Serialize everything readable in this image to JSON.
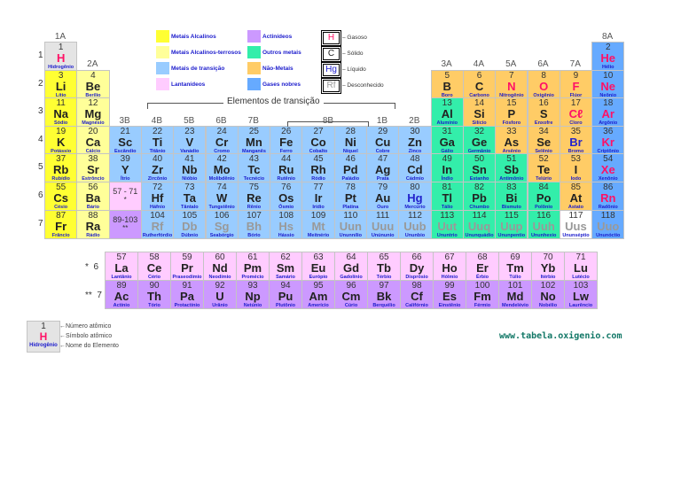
{
  "colors": {
    "alk": "#ffff33",
    "ae": "#ffff99",
    "tr": "#99ccff",
    "lan": "#ffccff",
    "act": "#cc99ff",
    "oth": "#33eeaa",
    "non": "#ffcc66",
    "nob": "#66aaff",
    "none": "#ffffff",
    "h": "#e4e4e4"
  },
  "state_colors": {
    "g": "#ff1166",
    "s": "#222222",
    "l": "#2222cc",
    "u": "#999999"
  },
  "groups": [
    "1A",
    "2A",
    "3B",
    "4B",
    "5B",
    "6B",
    "7B",
    "8B",
    "1B",
    "2B",
    "3A",
    "4A",
    "5A",
    "6A",
    "7A",
    "8A"
  ],
  "periods": [
    "1",
    "2",
    "3",
    "4",
    "5",
    "6",
    "7"
  ],
  "transition_title": "Elementos de transição",
  "legend": {
    "alk": "Metais Alcalinos",
    "ae": "Metais Alcalinos-terrosos",
    "tr": "Metais de transição",
    "lan": "Lantanídeos",
    "act": "Actinídeos",
    "oth": "Outros metais",
    "non": "Não-Metais",
    "nob": "Gases nobres"
  },
  "states": [
    {
      "sym": "H",
      "label": "Gasoso",
      "state": "g"
    },
    {
      "sym": "C",
      "label": "Sólido",
      "state": "s"
    },
    {
      "sym": "Hg",
      "label": "Líquido",
      "state": "l"
    },
    {
      "sym": "Rf",
      "label": "Desconhecido",
      "state": "u"
    }
  ],
  "placeholders": {
    "lan": {
      "range": "57 - 71",
      "mark": "*"
    },
    "act": {
      "range": "89-103",
      "mark": "**"
    }
  },
  "fblock_labels": {
    "lan": "*  6",
    "act": "**  7"
  },
  "key": {
    "num": "1",
    "sym": "H",
    "name": "Hidrogênio",
    "labels": [
      "Número atômico",
      "Símbolo atômico",
      "Nome do Elemento"
    ]
  },
  "website": "www.tabela.oxigenio.com",
  "elements": [
    [
      1,
      "H",
      "Hidrogênio",
      "h",
      "g",
      1,
      1
    ],
    [
      2,
      "He",
      "Hélio",
      "nob",
      "g",
      18,
      1
    ],
    [
      3,
      "Li",
      "Lítio",
      "alk",
      "s",
      1,
      2
    ],
    [
      4,
      "Be",
      "Berílio",
      "ae",
      "s",
      2,
      2
    ],
    [
      5,
      "B",
      "Boro",
      "non",
      "s",
      13,
      2
    ],
    [
      6,
      "C",
      "Carbono",
      "non",
      "s",
      14,
      2
    ],
    [
      7,
      "N",
      "Nitrogênio",
      "non",
      "g",
      15,
      2
    ],
    [
      8,
      "O",
      "Oxigênio",
      "non",
      "g",
      16,
      2
    ],
    [
      9,
      "F",
      "Flúor",
      "non",
      "g",
      17,
      2
    ],
    [
      10,
      "Ne",
      "Neônio",
      "nob",
      "g",
      18,
      2
    ],
    [
      11,
      "Na",
      "Sódio",
      "alk",
      "s",
      1,
      3
    ],
    [
      12,
      "Mg",
      "Magnésio",
      "ae",
      "s",
      2,
      3
    ],
    [
      13,
      "Al",
      "Alumínio",
      "oth",
      "s",
      13,
      3
    ],
    [
      14,
      "Si",
      "Silício",
      "non",
      "s",
      14,
      3
    ],
    [
      15,
      "P",
      "Fósforo",
      "non",
      "s",
      15,
      3
    ],
    [
      16,
      "S",
      "Enxofre",
      "non",
      "s",
      16,
      3
    ],
    [
      17,
      "Cℓ",
      "Cloro",
      "non",
      "g",
      17,
      3
    ],
    [
      18,
      "Ar",
      "Argônio",
      "nob",
      "g",
      18,
      3
    ],
    [
      19,
      "K",
      "Potássio",
      "alk",
      "s",
      1,
      4
    ],
    [
      20,
      "Ca",
      "Cálcio",
      "ae",
      "s",
      2,
      4
    ],
    [
      21,
      "Sc",
      "Escândio",
      "tr",
      "s",
      3,
      4
    ],
    [
      22,
      "Ti",
      "Titânio",
      "tr",
      "s",
      4,
      4
    ],
    [
      23,
      "V",
      "Vanádio",
      "tr",
      "s",
      5,
      4
    ],
    [
      24,
      "Cr",
      "Cromo",
      "tr",
      "s",
      6,
      4
    ],
    [
      25,
      "Mn",
      "Manganês",
      "tr",
      "s",
      7,
      4
    ],
    [
      26,
      "Fe",
      "Ferro",
      "tr",
      "s",
      8,
      4
    ],
    [
      27,
      "Co",
      "Cobalto",
      "tr",
      "s",
      9,
      4
    ],
    [
      28,
      "Ni",
      "Níquel",
      "tr",
      "s",
      10,
      4
    ],
    [
      29,
      "Cu",
      "Cobre",
      "tr",
      "s",
      11,
      4
    ],
    [
      30,
      "Zn",
      "Zinco",
      "tr",
      "s",
      12,
      4
    ],
    [
      31,
      "Ga",
      "Gálio",
      "oth",
      "s",
      13,
      4
    ],
    [
      32,
      "Ge",
      "Germânio",
      "oth",
      "s",
      14,
      4
    ],
    [
      33,
      "As",
      "Arsênio",
      "non",
      "s",
      15,
      4
    ],
    [
      34,
      "Se",
      "Selênio",
      "non",
      "s",
      16,
      4
    ],
    [
      35,
      "Br",
      "Bromo",
      "non",
      "l",
      17,
      4
    ],
    [
      36,
      "Kr",
      "Criptônio",
      "nob",
      "g",
      18,
      4
    ],
    [
      37,
      "Rb",
      "Rubídio",
      "alk",
      "s",
      1,
      5
    ],
    [
      38,
      "Sr",
      "Estrôncio",
      "ae",
      "s",
      2,
      5
    ],
    [
      39,
      "Y",
      "Ítrio",
      "tr",
      "s",
      3,
      5
    ],
    [
      40,
      "Zr",
      "Zircônio",
      "tr",
      "s",
      4,
      5
    ],
    [
      41,
      "Nb",
      "Nióbio",
      "tr",
      "s",
      5,
      5
    ],
    [
      42,
      "Mo",
      "Molibdênio",
      "tr",
      "s",
      6,
      5
    ],
    [
      43,
      "Tc",
      "Tecnécio",
      "tr",
      "s",
      7,
      5
    ],
    [
      44,
      "Ru",
      "Rutênio",
      "tr",
      "s",
      8,
      5
    ],
    [
      45,
      "Rh",
      "Ródio",
      "tr",
      "s",
      9,
      5
    ],
    [
      46,
      "Pd",
      "Paládio",
      "tr",
      "s",
      10,
      5
    ],
    [
      47,
      "Ag",
      "Prata",
      "tr",
      "s",
      11,
      5
    ],
    [
      48,
      "Cd",
      "Cádmio",
      "tr",
      "s",
      12,
      5
    ],
    [
      49,
      "In",
      "Índio",
      "oth",
      "s",
      13,
      5
    ],
    [
      50,
      "Sn",
      "Estanho",
      "oth",
      "s",
      14,
      5
    ],
    [
      51,
      "Sb",
      "Antimônio",
      "oth",
      "s",
      15,
      5
    ],
    [
      52,
      "Te",
      "Telúrio",
      "non",
      "s",
      16,
      5
    ],
    [
      53,
      "I",
      "Iodo",
      "non",
      "s",
      17,
      5
    ],
    [
      54,
      "Xe",
      "Xenônio",
      "nob",
      "g",
      18,
      5
    ],
    [
      55,
      "Cs",
      "Césio",
      "alk",
      "s",
      1,
      6
    ],
    [
      56,
      "Ba",
      "Bário",
      "ae",
      "s",
      2,
      6
    ],
    [
      72,
      "Hf",
      "Háfnio",
      "tr",
      "s",
      4,
      6
    ],
    [
      73,
      "Ta",
      "Tântalo",
      "tr",
      "s",
      5,
      6
    ],
    [
      74,
      "W",
      "Tungstênio",
      "tr",
      "s",
      6,
      6
    ],
    [
      75,
      "Re",
      "Rênio",
      "tr",
      "s",
      7,
      6
    ],
    [
      76,
      "Os",
      "Ósmio",
      "tr",
      "s",
      8,
      6
    ],
    [
      77,
      "Ir",
      "Irídio",
      "tr",
      "s",
      9,
      6
    ],
    [
      78,
      "Pt",
      "Platina",
      "tr",
      "s",
      10,
      6
    ],
    [
      79,
      "Au",
      "Ouro",
      "tr",
      "s",
      11,
      6
    ],
    [
      80,
      "Hg",
      "Mercúrio",
      "tr",
      "l",
      12,
      6
    ],
    [
      81,
      "Tl",
      "Tálio",
      "oth",
      "s",
      13,
      6
    ],
    [
      82,
      "Pb",
      "Chumbo",
      "oth",
      "s",
      14,
      6
    ],
    [
      83,
      "Bi",
      "Bismuto",
      "oth",
      "s",
      15,
      6
    ],
    [
      84,
      "Po",
      "Polônio",
      "oth",
      "s",
      16,
      6
    ],
    [
      85,
      "At",
      "Astato",
      "non",
      "s",
      17,
      6
    ],
    [
      86,
      "Rn",
      "Radônio",
      "nob",
      "g",
      18,
      6
    ],
    [
      87,
      "Fr",
      "Frâncio",
      "alk",
      "s",
      1,
      7
    ],
    [
      88,
      "Ra",
      "Rádio",
      "ae",
      "s",
      2,
      7
    ],
    [
      104,
      "Rf",
      "Rutherfórdio",
      "tr",
      "u",
      4,
      7
    ],
    [
      105,
      "Db",
      "Dúbnio",
      "tr",
      "u",
      5,
      7
    ],
    [
      106,
      "Sg",
      "Seabórgio",
      "tr",
      "u",
      6,
      7
    ],
    [
      107,
      "Bh",
      "Bório",
      "tr",
      "u",
      7,
      7
    ],
    [
      108,
      "Hs",
      "Hássio",
      "tr",
      "u",
      8,
      7
    ],
    [
      109,
      "Mt",
      "Meitnério",
      "tr",
      "u",
      9,
      7
    ],
    [
      110,
      "Uun",
      "Ununnílio",
      "tr",
      "u",
      10,
      7
    ],
    [
      111,
      "Uuu",
      "Unúnunio",
      "tr",
      "u",
      11,
      7
    ],
    [
      112,
      "Uub",
      "Ununbio",
      "tr",
      "u",
      12,
      7
    ],
    [
      113,
      "Uut",
      "Ununtrio",
      "oth",
      "u",
      13,
      7
    ],
    [
      114,
      "Uuq",
      "Ununquádio",
      "oth",
      "u",
      14,
      7
    ],
    [
      115,
      "Uup",
      "Ununpentio",
      "oth",
      "u",
      15,
      7
    ],
    [
      116,
      "Uuh",
      "Ununhexio",
      "oth",
      "u",
      16,
      7
    ],
    [
      117,
      "Uus",
      "Ununséptio",
      "none",
      "u",
      17,
      7
    ],
    [
      118,
      "Uuo",
      "Ununóctio",
      "nob",
      "u",
      18,
      7
    ]
  ],
  "lanthanides": [
    [
      57,
      "La",
      "Lantânio"
    ],
    [
      58,
      "Ce",
      "Cério"
    ],
    [
      59,
      "Pr",
      "Praseodímio"
    ],
    [
      60,
      "Nd",
      "Neodímio"
    ],
    [
      61,
      "Pm",
      "Promécio"
    ],
    [
      62,
      "Sm",
      "Samário"
    ],
    [
      63,
      "Eu",
      "Európio"
    ],
    [
      64,
      "Gd",
      "Gadolínio"
    ],
    [
      65,
      "Tb",
      "Térbio"
    ],
    [
      66,
      "Dy",
      "Disprósio"
    ],
    [
      67,
      "Ho",
      "Hólmio"
    ],
    [
      68,
      "Er",
      "Érbio"
    ],
    [
      69,
      "Tm",
      "Túlio"
    ],
    [
      70,
      "Yb",
      "Itérbio"
    ],
    [
      71,
      "Lu",
      "Lutécio"
    ]
  ],
  "actinides": [
    [
      89,
      "Ac",
      "Actínio"
    ],
    [
      90,
      "Th",
      "Tório"
    ],
    [
      91,
      "Pa",
      "Protactínio"
    ],
    [
      92,
      "U",
      "Urânio"
    ],
    [
      93,
      "Np",
      "Netúnio"
    ],
    [
      94,
      "Pu",
      "Plutônio"
    ],
    [
      95,
      "Am",
      "Amerício"
    ],
    [
      96,
      "Cm",
      "Cúrio"
    ],
    [
      97,
      "Bk",
      "Berquélio"
    ],
    [
      98,
      "Cf",
      "Califórnio"
    ],
    [
      99,
      "Es",
      "Einstênio"
    ],
    [
      100,
      "Fm",
      "Férmio"
    ],
    [
      101,
      "Md",
      "Mendelévio"
    ],
    [
      102,
      "No",
      "Nobélio"
    ],
    [
      103,
      "Lw",
      "Laurêncio"
    ]
  ]
}
